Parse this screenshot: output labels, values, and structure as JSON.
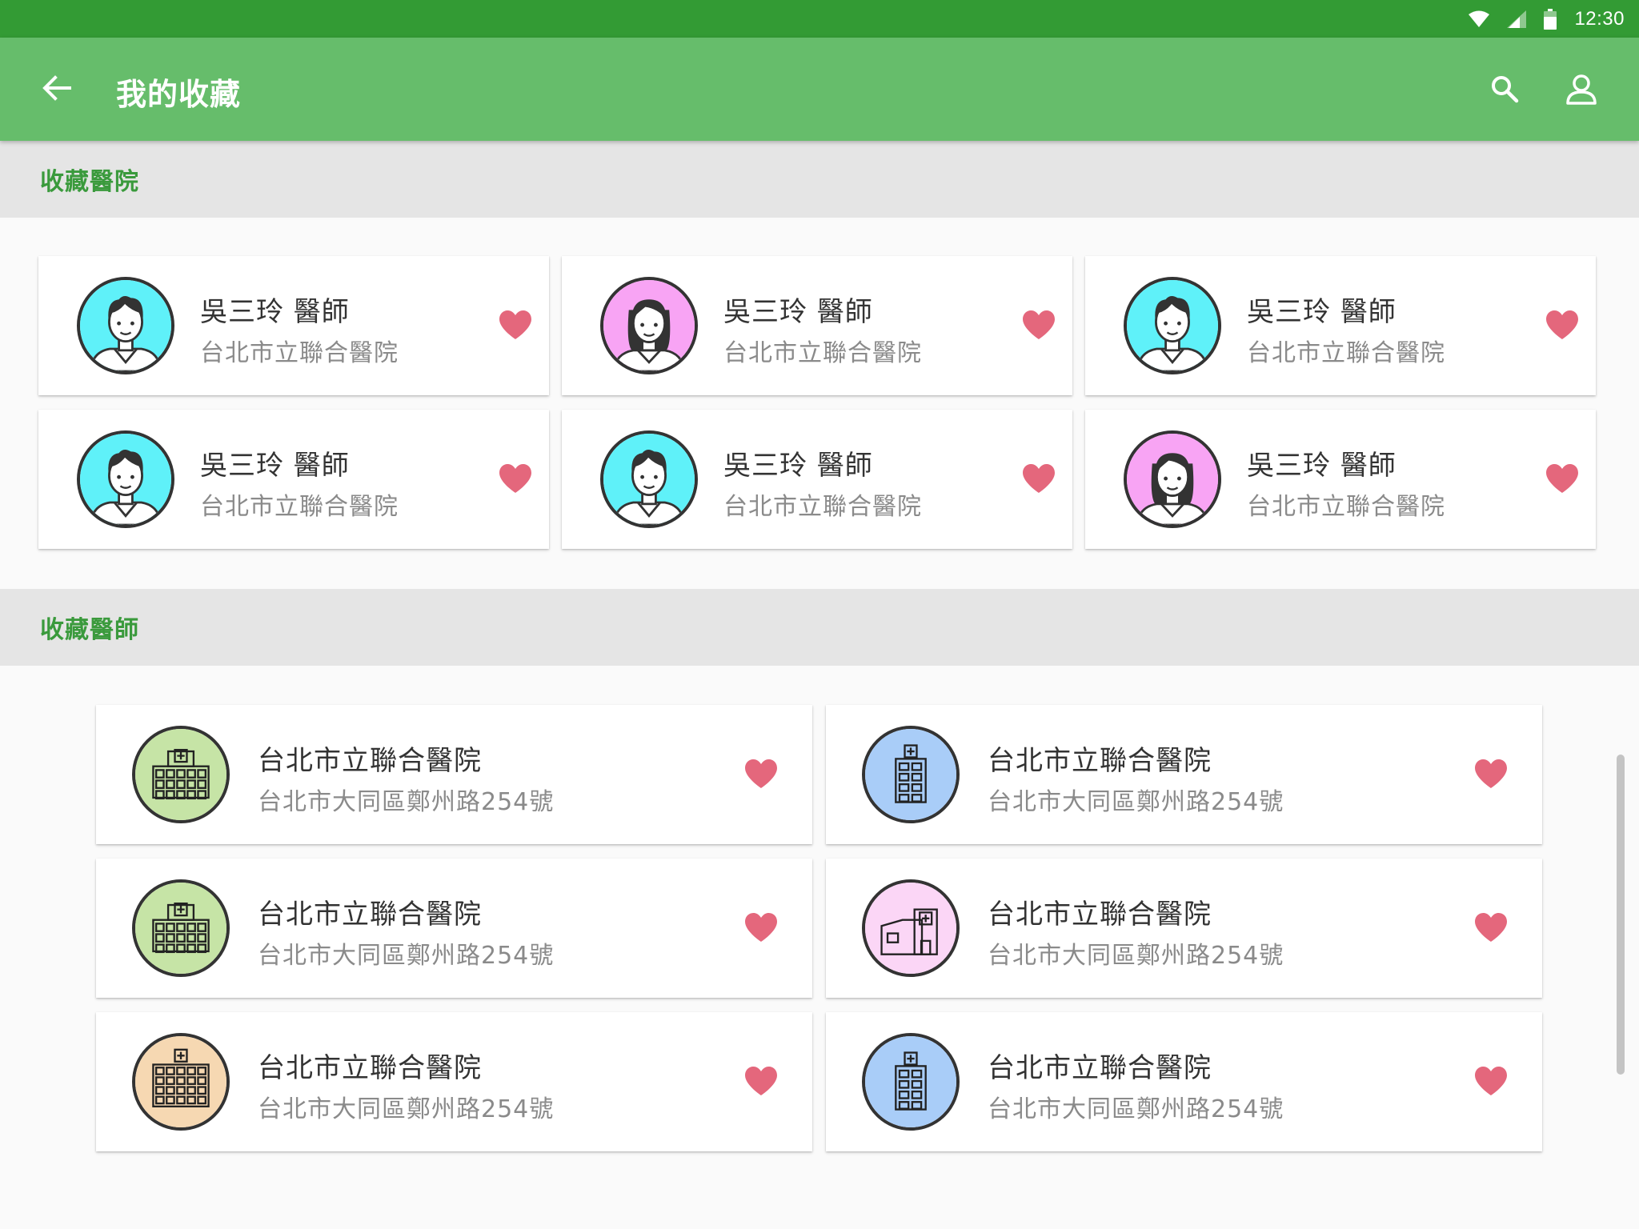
{
  "status_bar": {
    "time": "12:30"
  },
  "app_bar": {
    "title": "我的收藏"
  },
  "sections": {
    "first": {
      "title": "收藏醫院"
    },
    "second": {
      "title": "收藏醫師"
    }
  },
  "doctors": [
    {
      "name": "吳三玲 醫師",
      "hospital": "台北市立聯合醫院",
      "avatar": "male-doctor-icon",
      "bg": "#5ff1f9"
    },
    {
      "name": "吳三玲 醫師",
      "hospital": "台北市立聯合醫院",
      "avatar": "female-doctor-icon",
      "bg": "#f8a4f4"
    },
    {
      "name": "吳三玲 醫師",
      "hospital": "台北市立聯合醫院",
      "avatar": "male-doctor-icon",
      "bg": "#5ff1f9"
    },
    {
      "name": "吳三玲 醫師",
      "hospital": "台北市立聯合醫院",
      "avatar": "male-doctor-icon",
      "bg": "#5ff1f9"
    },
    {
      "name": "吳三玲 醫師",
      "hospital": "台北市立聯合醫院",
      "avatar": "male-doctor-icon",
      "bg": "#5ff1f9"
    },
    {
      "name": "吳三玲 醫師",
      "hospital": "台北市立聯合醫院",
      "avatar": "female-doctor-icon",
      "bg": "#f8a4f4"
    }
  ],
  "hospitals": [
    {
      "name": "台北市立聯合醫院",
      "address": "台北市大同區鄭州路254號",
      "icon": "wide-hospital-building-icon",
      "bg": "#c6e4a6"
    },
    {
      "name": "台北市立聯合醫院",
      "address": "台北市大同區鄭州路254號",
      "icon": "tall-hospital-building-icon",
      "bg": "#a9cdf8"
    },
    {
      "name": "台北市立聯合醫院",
      "address": "台北市大同區鄭州路254號",
      "icon": "wide-hospital-building-icon",
      "bg": "#c6e4a6"
    },
    {
      "name": "台北市立聯合醫院",
      "address": "台北市大同區鄭州路254號",
      "icon": "clinic-building-icon",
      "bg": "#fbd6f6"
    },
    {
      "name": "台北市立聯合醫院",
      "address": "台北市大同區鄭州路254號",
      "icon": "large-hospital-building-icon",
      "bg": "#f6d8b2"
    },
    {
      "name": "台北市立聯合醫院",
      "address": "台北市大同區鄭州路254號",
      "icon": "tall-hospital-building-icon",
      "bg": "#a9cdf8"
    }
  ],
  "colors": {
    "status_bar": "#339b34",
    "app_bar": "#66bd6b",
    "section_title": "#3a9a3c",
    "heart": "#e4677c"
  }
}
